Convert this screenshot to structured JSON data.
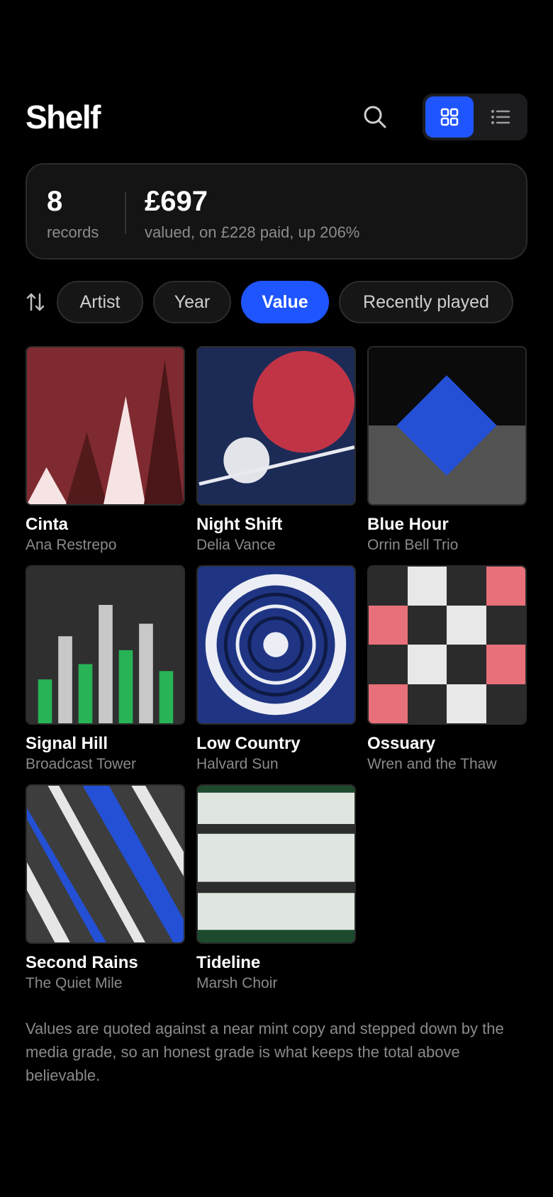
{
  "header": {
    "title": "Shelf",
    "search_icon": "search-icon",
    "view_grid_icon": "grid-view-icon",
    "view_list_icon": "list-view-icon",
    "active_view": "grid"
  },
  "summary": {
    "count": "8",
    "count_label": "records",
    "value": "£697",
    "value_label": "valued, on £228 paid, up 206%"
  },
  "sort": {
    "icon": "sort-icon",
    "options": [
      "Artist",
      "Year",
      "Value",
      "Recently played"
    ],
    "active": "Value"
  },
  "records": [
    {
      "title": "Cinta",
      "artist": "Ana Restrepo"
    },
    {
      "title": "Night Shift",
      "artist": "Delia Vance"
    },
    {
      "title": "Blue Hour",
      "artist": "Orrin Bell Trio"
    },
    {
      "title": "Signal Hill",
      "artist": "Broadcast Tower"
    },
    {
      "title": "Low Country",
      "artist": "Halvard Sun"
    },
    {
      "title": "Ossuary",
      "artist": "Wren and the Thaw"
    },
    {
      "title": "Second Rains",
      "artist": "The Quiet Mile"
    },
    {
      "title": "Tideline",
      "artist": "Marsh Choir"
    }
  ],
  "footnote": "Values are quoted against a near mint copy and stepped down by the media grade, so an honest grade is what keeps the total above believable.",
  "colors": {
    "accent": "#1f55ff",
    "background": "#000000",
    "card": "#141414",
    "muted_text": "#8a8a8a"
  }
}
